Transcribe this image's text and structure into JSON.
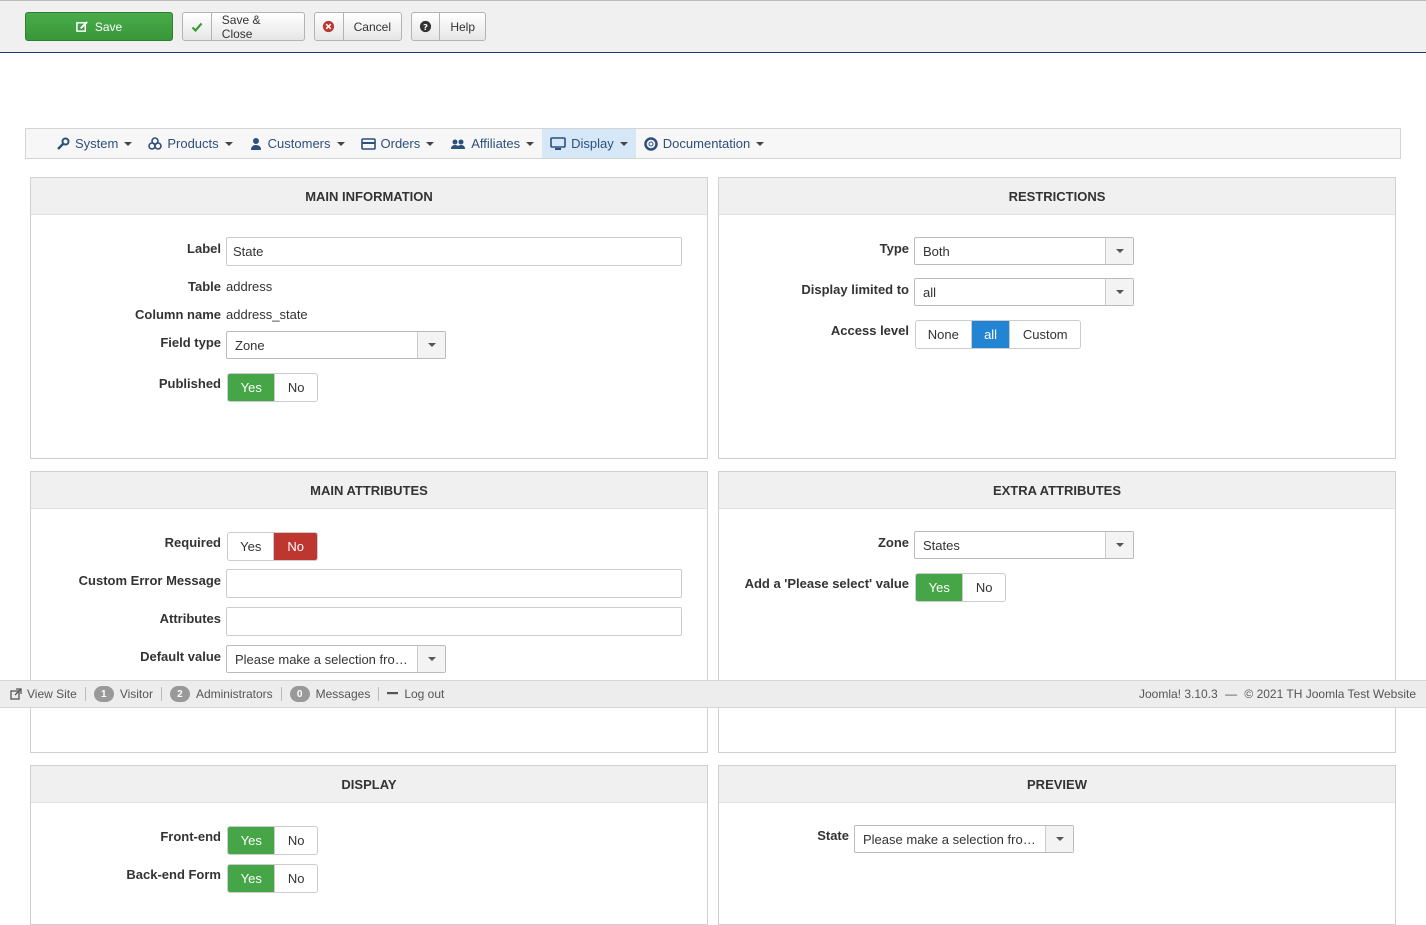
{
  "toolbar": {
    "save": "Save",
    "save_close": "Save & Close",
    "cancel": "Cancel",
    "help": "Help"
  },
  "menu": {
    "items": [
      {
        "label": "System",
        "icon": "wrench-icon"
      },
      {
        "label": "Products",
        "icon": "cubes-icon"
      },
      {
        "label": "Customers",
        "icon": "user-icon"
      },
      {
        "label": "Orders",
        "icon": "credit-card-icon"
      },
      {
        "label": "Affiliates",
        "icon": "users-icon"
      },
      {
        "label": "Display",
        "icon": "monitor-icon",
        "active": true
      },
      {
        "label": "Documentation",
        "icon": "lifebuoy-icon"
      }
    ]
  },
  "main_information": {
    "title": "MAIN INFORMATION",
    "label_label": "Label",
    "label_value": "State",
    "table_label": "Table",
    "table_value": "address",
    "column_label": "Column name",
    "column_value": "address_state",
    "fieldtype_label": "Field type",
    "fieldtype_value": "Zone",
    "published_label": "Published",
    "yes": "Yes",
    "no": "No"
  },
  "restrictions": {
    "title": "RESTRICTIONS",
    "type_label": "Type",
    "type_value": "Both",
    "display_limited_label": "Display limited to",
    "display_limited_value": "all",
    "access_label": "Access level",
    "access_none": "None",
    "access_all": "all",
    "access_custom": "Custom"
  },
  "main_attributes": {
    "title": "MAIN ATTRIBUTES",
    "required_label": "Required",
    "yes": "Yes",
    "no": "No",
    "error_label": "Custom Error Message",
    "error_value": "",
    "attributes_label": "Attributes",
    "attributes_value": "",
    "default_label": "Default value",
    "default_value": "Please make a selection from…"
  },
  "extra_attributes": {
    "title": "EXTRA ATTRIBUTES",
    "zone_label": "Zone",
    "zone_value": "States",
    "please_select_label": "Add a 'Please select' value",
    "yes": "Yes",
    "no": "No"
  },
  "display": {
    "title": "DISPLAY",
    "frontend_label": "Front-end",
    "backend_label": "Back-end Form",
    "yes": "Yes",
    "no": "No"
  },
  "preview": {
    "title": "PREVIEW",
    "state_label": "State",
    "state_value": "Please make a selection from…"
  },
  "statusbar": {
    "view_site": "View Site",
    "visitor_count": "1",
    "visitor_label": "Visitor",
    "admin_count": "2",
    "admin_label": "Administrators",
    "messages_count": "0",
    "messages_label": "Messages",
    "logout": "Log out",
    "version": "Joomla! 3.10.3",
    "dash": "—",
    "copyright": "© 2021 TH Joomla Test Website"
  },
  "colors": {
    "save_green": "#46a546",
    "toggle_red": "#bd362f",
    "toggle_blue": "#2384d3",
    "menu_link": "#2d4f7c"
  }
}
